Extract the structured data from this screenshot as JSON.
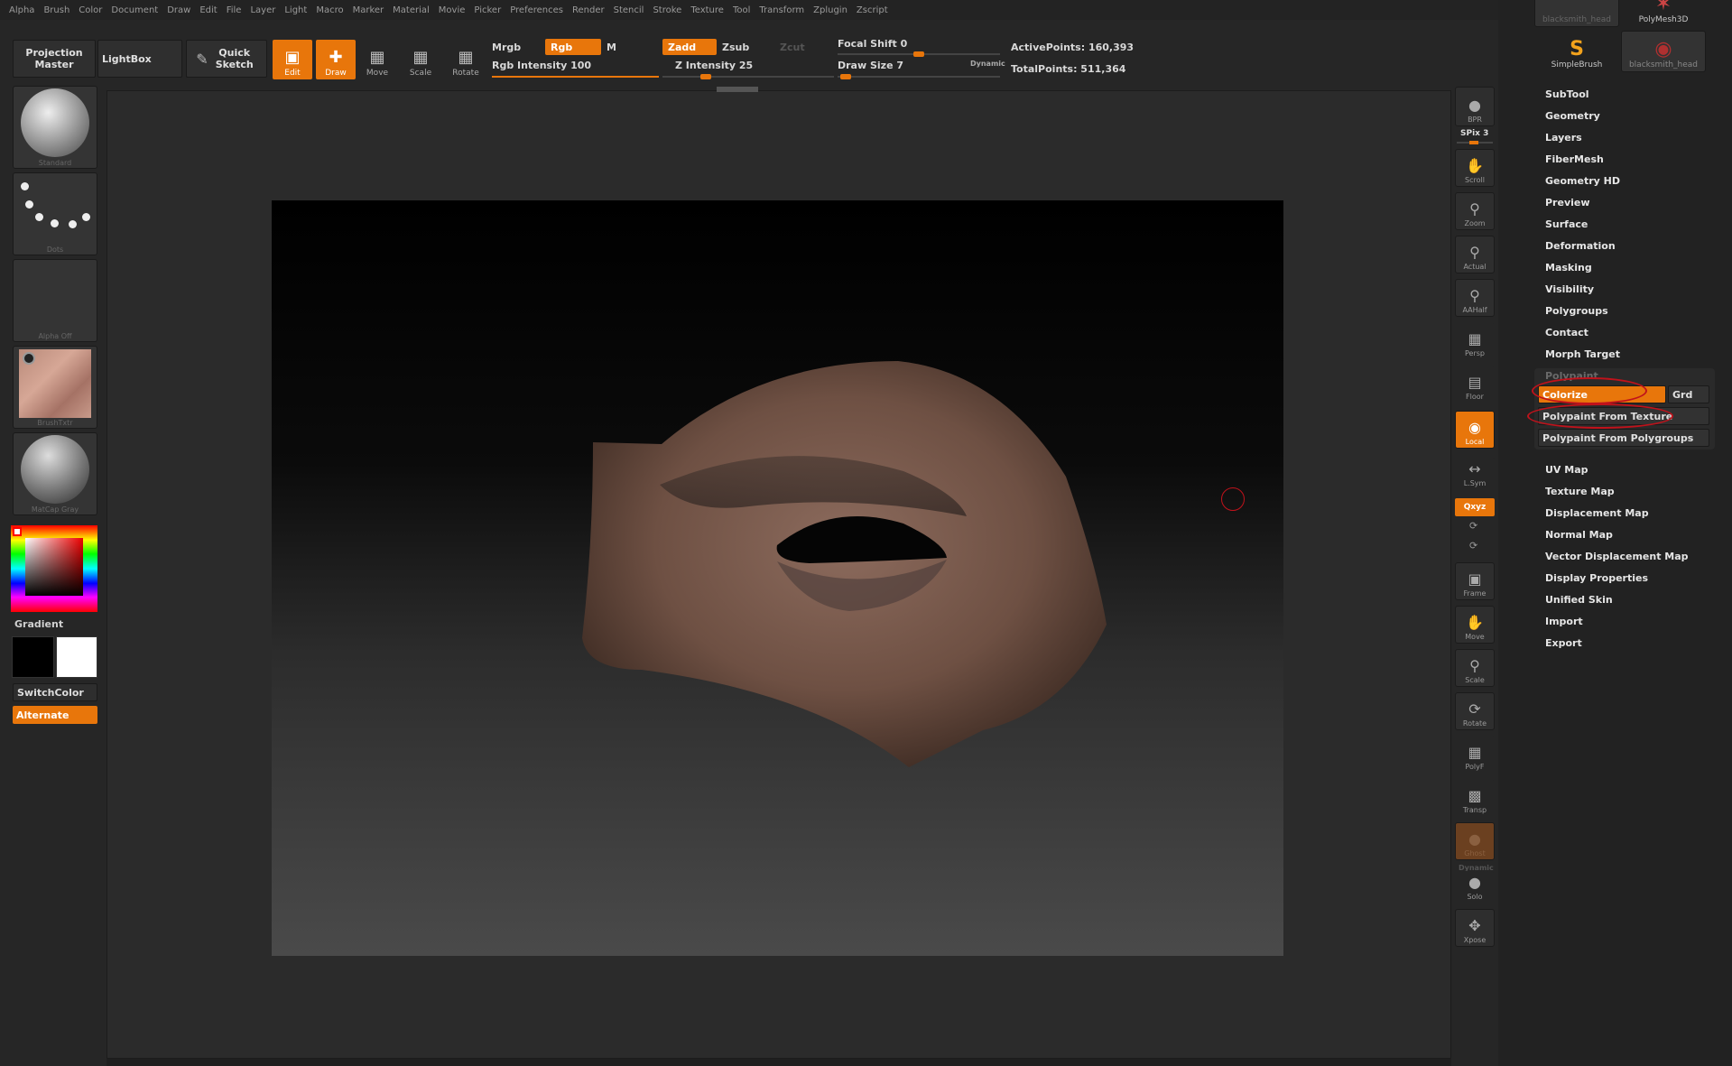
{
  "menubar": [
    "Alpha",
    "Brush",
    "Color",
    "Document",
    "Draw",
    "Edit",
    "File",
    "Layer",
    "Light",
    "Macro",
    "Marker",
    "Material",
    "Movie",
    "Picker",
    "Preferences",
    "Render",
    "Stencil",
    "Stroke",
    "Texture",
    "Tool",
    "Transform",
    "Zplugin",
    "Zscript"
  ],
  "toolbar": {
    "projection_master": "Projection Master",
    "lightbox": "LightBox",
    "quick_sketch": "Quick Sketch",
    "edit": "Edit",
    "draw": "Draw",
    "move": "Move",
    "scale": "Scale",
    "rotate": "Rotate",
    "mrgb": "Mrgb",
    "rgb": "Rgb",
    "m": "M",
    "zadd": "Zadd",
    "zsub": "Zsub",
    "zcut": "Zcut",
    "rgb_intensity": "Rgb Intensity 100",
    "z_intensity": "Z Intensity 25",
    "focal_shift": "Focal Shift 0",
    "draw_size": "Draw Size 7",
    "dynamic": "Dynamic",
    "active_points": "ActivePoints: 160,393",
    "total_points": "TotalPoints: 511,364",
    "rgb_intensity_value": 1.0,
    "z_intensity_value": 0.25,
    "focal_shift_value": 0.5,
    "draw_size_value": 0.05
  },
  "left_shelf": {
    "brush": "Standard",
    "stroke": "Dots",
    "alpha": "Alpha Off",
    "texture": "BrushTxtr",
    "material": "MatCap Gray",
    "gradient": "Gradient",
    "switch_color": "SwitchColor",
    "alternate": "Alternate"
  },
  "right_shelf": {
    "bpr": "BPR",
    "spix": "SPix 3",
    "scroll": "Scroll",
    "zoom": "Zoom",
    "actual": "Actual",
    "aahalf": "AAHalf",
    "persp": "Persp",
    "floor": "Floor",
    "local": "Local",
    "lsym": "L.Sym",
    "xyz": "Qxyz",
    "frame": "Frame",
    "move": "Move",
    "scale": "Scale",
    "rotate": "Rotate",
    "polyf": "PolyF",
    "transp": "Transp",
    "ghost": "Ghost",
    "dynamic": "Dynamic",
    "solo": "Solo",
    "xpose": "Xpose"
  },
  "tool_palette": {
    "thumbs": [
      "blacksmith_head",
      "PolyMesh3D",
      "SimpleBrush",
      "blacksmith_head"
    ],
    "items": [
      "SubTool",
      "Geometry",
      "Layers",
      "FiberMesh",
      "Geometry HD",
      "Preview",
      "Surface",
      "Deformation",
      "Masking",
      "Visibility",
      "Polygroups",
      "Contact",
      "Morph Target"
    ],
    "polypaint": "Polypaint",
    "colorize": "Colorize",
    "grd": "Grd",
    "from_texture": "Polypaint From Texture",
    "from_polygroups": "Polypaint From Polygroups",
    "items_after": [
      "UV Map",
      "Texture Map",
      "Displacement Map",
      "Normal Map",
      "Vector Displacement Map",
      "Display Properties",
      "Unified Skin",
      "Import",
      "Export"
    ]
  },
  "colors": {
    "accent": "#e8760b",
    "annotation": "#c0121b",
    "background": "#1f1f1f"
  }
}
